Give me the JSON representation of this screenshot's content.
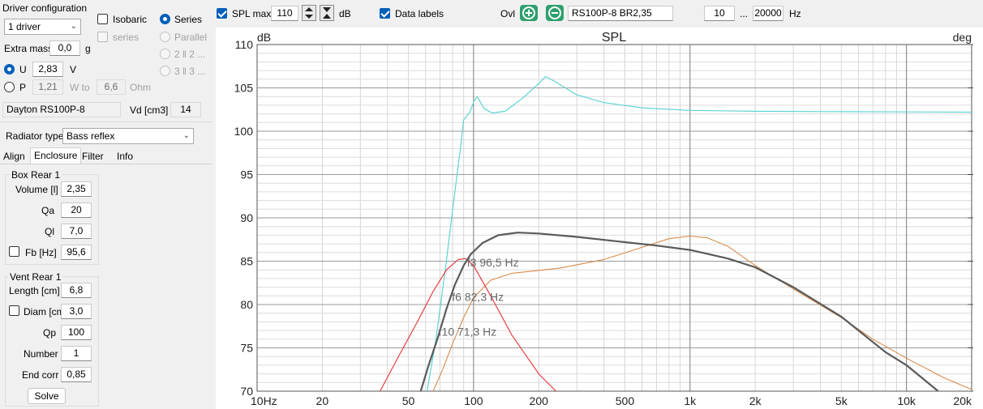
{
  "left_panel": {
    "driver_config": {
      "title": "Driver configuration",
      "drivers_select": "1 driver",
      "isobaric_label": "Isobaric",
      "series_label": "Series",
      "series_check_label": "series",
      "parallel_label": "Parallel",
      "opt_2": "2 ‖ 2 ...",
      "opt_3": "3 ‖ 3 ...",
      "extra_mass_label": "Extra mass",
      "extra_mass_value": "0,0",
      "extra_mass_unit": "g",
      "u_label": "U",
      "u_value": "2,83",
      "u_unit": "V",
      "p_label": "P",
      "p_value": "1,21",
      "w_to_label": "W to",
      "ohm_value": "6,6",
      "ohm_unit": "Ohm",
      "driver_name": "Dayton RS100P-8",
      "vd_label": "Vd [cm3]",
      "vd_value": "14"
    },
    "radiator_type_label": "Radiator type",
    "radiator_type_value": "Bass reflex",
    "tabs": [
      "Align",
      "Enclosure",
      "Filter",
      "Info"
    ],
    "box": {
      "title": "Box Rear 1",
      "volume_label": "Volume [l]",
      "volume_value": "2,35",
      "qa_label": "Qa",
      "qa_value": "20",
      "ql_label": "Ql",
      "ql_value": "7,0",
      "fb_label": "Fb [Hz]",
      "fb_value": "95,6"
    },
    "vent": {
      "title": "Vent Rear 1",
      "length_label": "Length [cm]",
      "length_value": "6,8",
      "diam_label": "Diam [cm]",
      "diam_value": "3,0",
      "qp_label": "Qp",
      "qp_value": "100",
      "number_label": "Number",
      "number_value": "1",
      "endcorr_label": "End corr",
      "endcorr_value": "0,85",
      "solve_label": "Solve"
    }
  },
  "toolbar": {
    "spl_max_label": "SPL max",
    "spl_max_value": "110",
    "db_unit": "dB",
    "data_labels_label": "Data labels",
    "ovl_label": "Ovl",
    "project_name": "RS100P-8 BR2,35",
    "freq_min": "10",
    "freq_sep": "...",
    "freq_max": "20000",
    "hz_unit": "Hz"
  },
  "chart_data": {
    "type": "line",
    "title": "SPL",
    "ylabel": "dB",
    "y2label": "deg",
    "xscale": "log",
    "xlim": [
      10,
      20000
    ],
    "ylim": [
      70,
      110
    ],
    "grid": true,
    "xtick_labels": [
      {
        "v": 10,
        "t": "10Hz"
      },
      {
        "v": 20,
        "t": "20"
      },
      {
        "v": 50,
        "t": "50"
      },
      {
        "v": 100,
        "t": "100"
      },
      {
        "v": 200,
        "t": "200"
      },
      {
        "v": 500,
        "t": "500"
      },
      {
        "v": 1000,
        "t": "1k"
      },
      {
        "v": 2000,
        "t": "2k"
      },
      {
        "v": 5000,
        "t": "5k"
      },
      {
        "v": 10000,
        "t": "10k"
      },
      {
        "v": 20000,
        "t": "20k"
      }
    ],
    "yticks": [
      110,
      105,
      100,
      95,
      90,
      85,
      80,
      75,
      70
    ],
    "series": [
      {
        "color": "#5fd3d3",
        "width": 1.2,
        "points": [
          [
            61,
            70
          ],
          [
            67,
            76
          ],
          [
            74,
            84
          ],
          [
            81,
            92
          ],
          [
            87,
            98
          ],
          [
            90,
            101.3
          ],
          [
            96,
            102.2
          ],
          [
            101,
            103.6
          ],
          [
            104,
            104
          ],
          [
            112,
            102.6
          ],
          [
            122,
            102.1
          ],
          [
            140,
            102.3
          ],
          [
            170,
            103.9
          ],
          [
            200,
            105.5
          ],
          [
            215,
            106.3
          ],
          [
            235,
            105.8
          ],
          [
            300,
            104.2
          ],
          [
            400,
            103.3
          ],
          [
            600,
            102.7
          ],
          [
            1000,
            102.4
          ],
          [
            2000,
            102.3
          ],
          [
            5000,
            102.25
          ],
          [
            20000,
            102.2
          ]
        ]
      },
      {
        "color": "#d88a4a",
        "width": 1.1,
        "points": [
          [
            65,
            70
          ],
          [
            72,
            72.5
          ],
          [
            80,
            75.5
          ],
          [
            90,
            78.5
          ],
          [
            100,
            80.8
          ],
          [
            120,
            82.8
          ],
          [
            150,
            83.6
          ],
          [
            250,
            84.2
          ],
          [
            400,
            85.2
          ],
          [
            600,
            86.6
          ],
          [
            800,
            87.6
          ],
          [
            1000,
            87.9
          ],
          [
            1200,
            87.7
          ],
          [
            1500,
            86.7
          ],
          [
            2000,
            84.5
          ],
          [
            3000,
            81.8
          ],
          [
            5000,
            78.5
          ],
          [
            7000,
            76
          ],
          [
            10000,
            73.8
          ],
          [
            15000,
            71.5
          ],
          [
            20000,
            70.2
          ]
        ]
      },
      {
        "color": "#e83030",
        "width": 1.1,
        "points": [
          [
            37,
            70
          ],
          [
            45,
            74
          ],
          [
            55,
            78
          ],
          [
            65,
            81.5
          ],
          [
            75,
            84
          ],
          [
            85,
            85.2
          ],
          [
            92,
            85.3
          ],
          [
            100,
            84.5
          ],
          [
            120,
            81
          ],
          [
            150,
            76.5
          ],
          [
            200,
            72
          ],
          [
            240,
            70
          ]
        ]
      },
      {
        "color": "#5a5a5a",
        "width": 2.2,
        "points": [
          [
            57,
            70
          ],
          [
            62,
            73
          ],
          [
            68,
            76
          ],
          [
            75,
            79.5
          ],
          [
            82,
            82.3
          ],
          [
            90,
            84.5
          ],
          [
            97,
            85.8
          ],
          [
            110,
            87.1
          ],
          [
            130,
            88
          ],
          [
            160,
            88.3
          ],
          [
            200,
            88.2
          ],
          [
            300,
            87.8
          ],
          [
            500,
            87.2
          ],
          [
            700,
            86.8
          ],
          [
            1000,
            86.3
          ],
          [
            1500,
            85.3
          ],
          [
            2000,
            84.3
          ],
          [
            3000,
            82
          ],
          [
            5000,
            78.6
          ],
          [
            8000,
            74.5
          ],
          [
            10000,
            73
          ],
          [
            14000,
            70
          ]
        ]
      }
    ],
    "annotations": [
      {
        "text": "f3 96,5 Hz",
        "x": 96.5,
        "y": 84.4
      },
      {
        "text": "f6 82,3 Hz",
        "x": 82.3,
        "y": 80.4
      },
      {
        "text": "f10 71,3 Hz",
        "x": 71.3,
        "y": 76.4
      }
    ]
  }
}
